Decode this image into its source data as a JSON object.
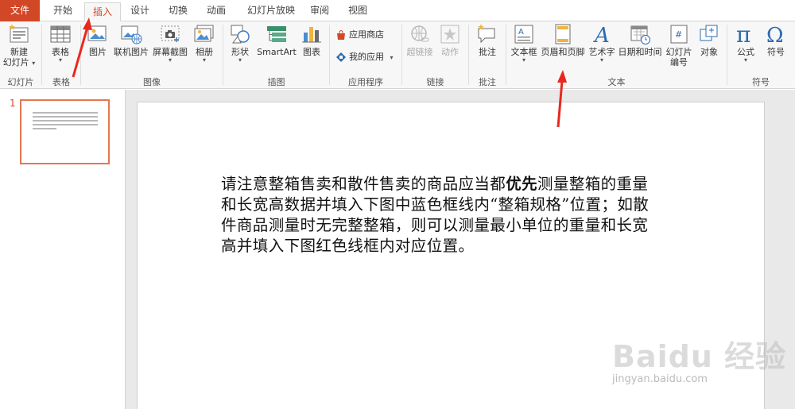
{
  "tabs": [
    {
      "label": "文件"
    },
    {
      "label": "开始"
    },
    {
      "label": "插入"
    },
    {
      "label": "设计"
    },
    {
      "label": "切换"
    },
    {
      "label": "动画"
    },
    {
      "label": "幻灯片放映"
    },
    {
      "label": "审阅"
    },
    {
      "label": "视图"
    }
  ],
  "ribbon": {
    "new_slide": {
      "line1": "新建",
      "line2": "幻灯片"
    },
    "table": "表格",
    "picture": "图片",
    "online_picture": "联机图片",
    "screenshot": "屏幕截图",
    "album": "相册",
    "shapes": "形状",
    "smartart": "SmartArt",
    "chart": "图表",
    "app_store": "应用商店",
    "my_apps": "我的应用",
    "hyperlink": "超链接",
    "action": "动作",
    "comment": "批注",
    "textbox": "文本框",
    "header_footer": "页眉和页脚",
    "wordart": "艺术字",
    "datetime": "日期和时间",
    "slide_number": {
      "line1": "幻灯片",
      "line2": "编号"
    },
    "object": "对象",
    "equation": "公式",
    "symbol": "符号",
    "groups": {
      "slides": "幻灯片",
      "tables": "表格",
      "images": "图像",
      "illustrations": "插图",
      "apps": "应用程序",
      "links": "链接",
      "comments": "批注",
      "text": "文本",
      "symbols": "符号"
    }
  },
  "thumbnail": {
    "number": "1"
  },
  "slide": {
    "text_before": "请注意整箱售卖和散件售卖的商品应当都",
    "text_bold": "优先",
    "text_after": "测量整箱的重量和长宽高数据并填入下图中蓝色框线内“整箱规格”位置；如散件商品测量时无完整整箱，则可以测量最小单位的重量和长宽高并填入下图红色线框内对应位置。"
  },
  "watermark": {
    "logo": "Baidu 经验",
    "url": "jingyan.baidu.com"
  },
  "colors": {
    "accent": "#d24726",
    "arrow": "#e8281e",
    "ribbon_bg": "#f7f7f7"
  }
}
